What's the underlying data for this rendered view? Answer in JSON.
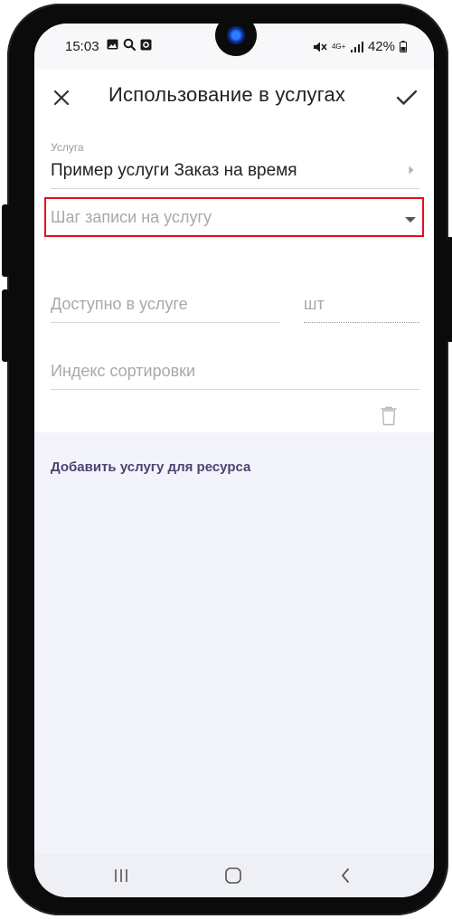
{
  "status_bar": {
    "time": "15:03",
    "network": "4G+",
    "battery": "42%"
  },
  "app_bar": {
    "title": "Использование в услугах"
  },
  "form": {
    "service": {
      "label": "Услуга",
      "value": "Пример услуги Заказ на время"
    },
    "booking_step": {
      "placeholder": "Шаг записи на услугу"
    },
    "available_in_service": {
      "placeholder": "Доступно в услуге",
      "unit": "шт"
    },
    "sort_index": {
      "placeholder": "Индекс сортировки"
    }
  },
  "add_service_link": "Добавить услугу для ресурса",
  "colors": {
    "accent_highlight": "#e0101c",
    "link": "#4a4470",
    "background": "#f3f4fb"
  },
  "icons": {
    "close": "close-icon",
    "confirm": "check-icon",
    "dropdown": "dropdown-arrow-icon",
    "chevron": "chevron-right-icon",
    "delete": "trash-icon"
  }
}
